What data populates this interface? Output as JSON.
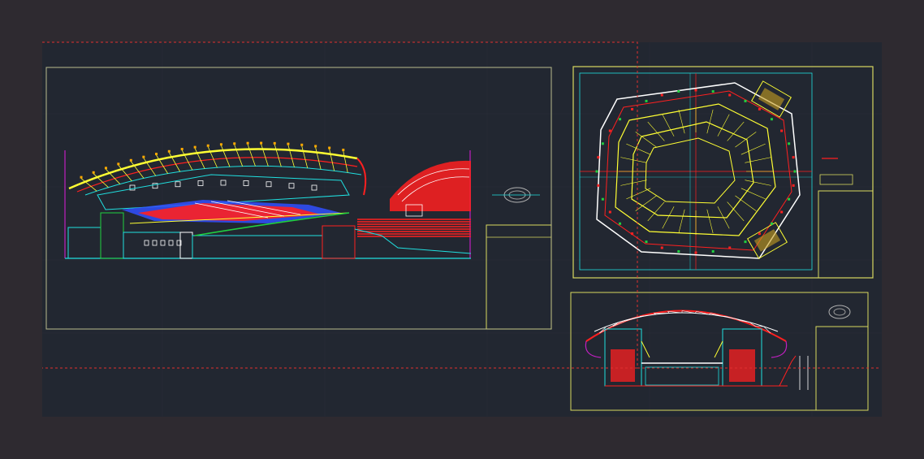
{
  "colors": {
    "workspace": "#2e2a30",
    "model_space": "#222731",
    "paper_frame": "#c8c86a",
    "sheet_border": "#9aa0e0",
    "viewport_dash": "#e03030",
    "title_block": "#d8d860",
    "roof": "#ffff33",
    "structure": "#20e0e0",
    "seating": "#ff2020",
    "glazing": "#ffffff",
    "column": "#c020c0",
    "green": "#20d040",
    "blue": "#3050ff"
  },
  "icons": {
    "overview_thumbnail": "stadium-thumbnail-icon",
    "section_thumbnail": "stadium-thumbnail-icon"
  }
}
